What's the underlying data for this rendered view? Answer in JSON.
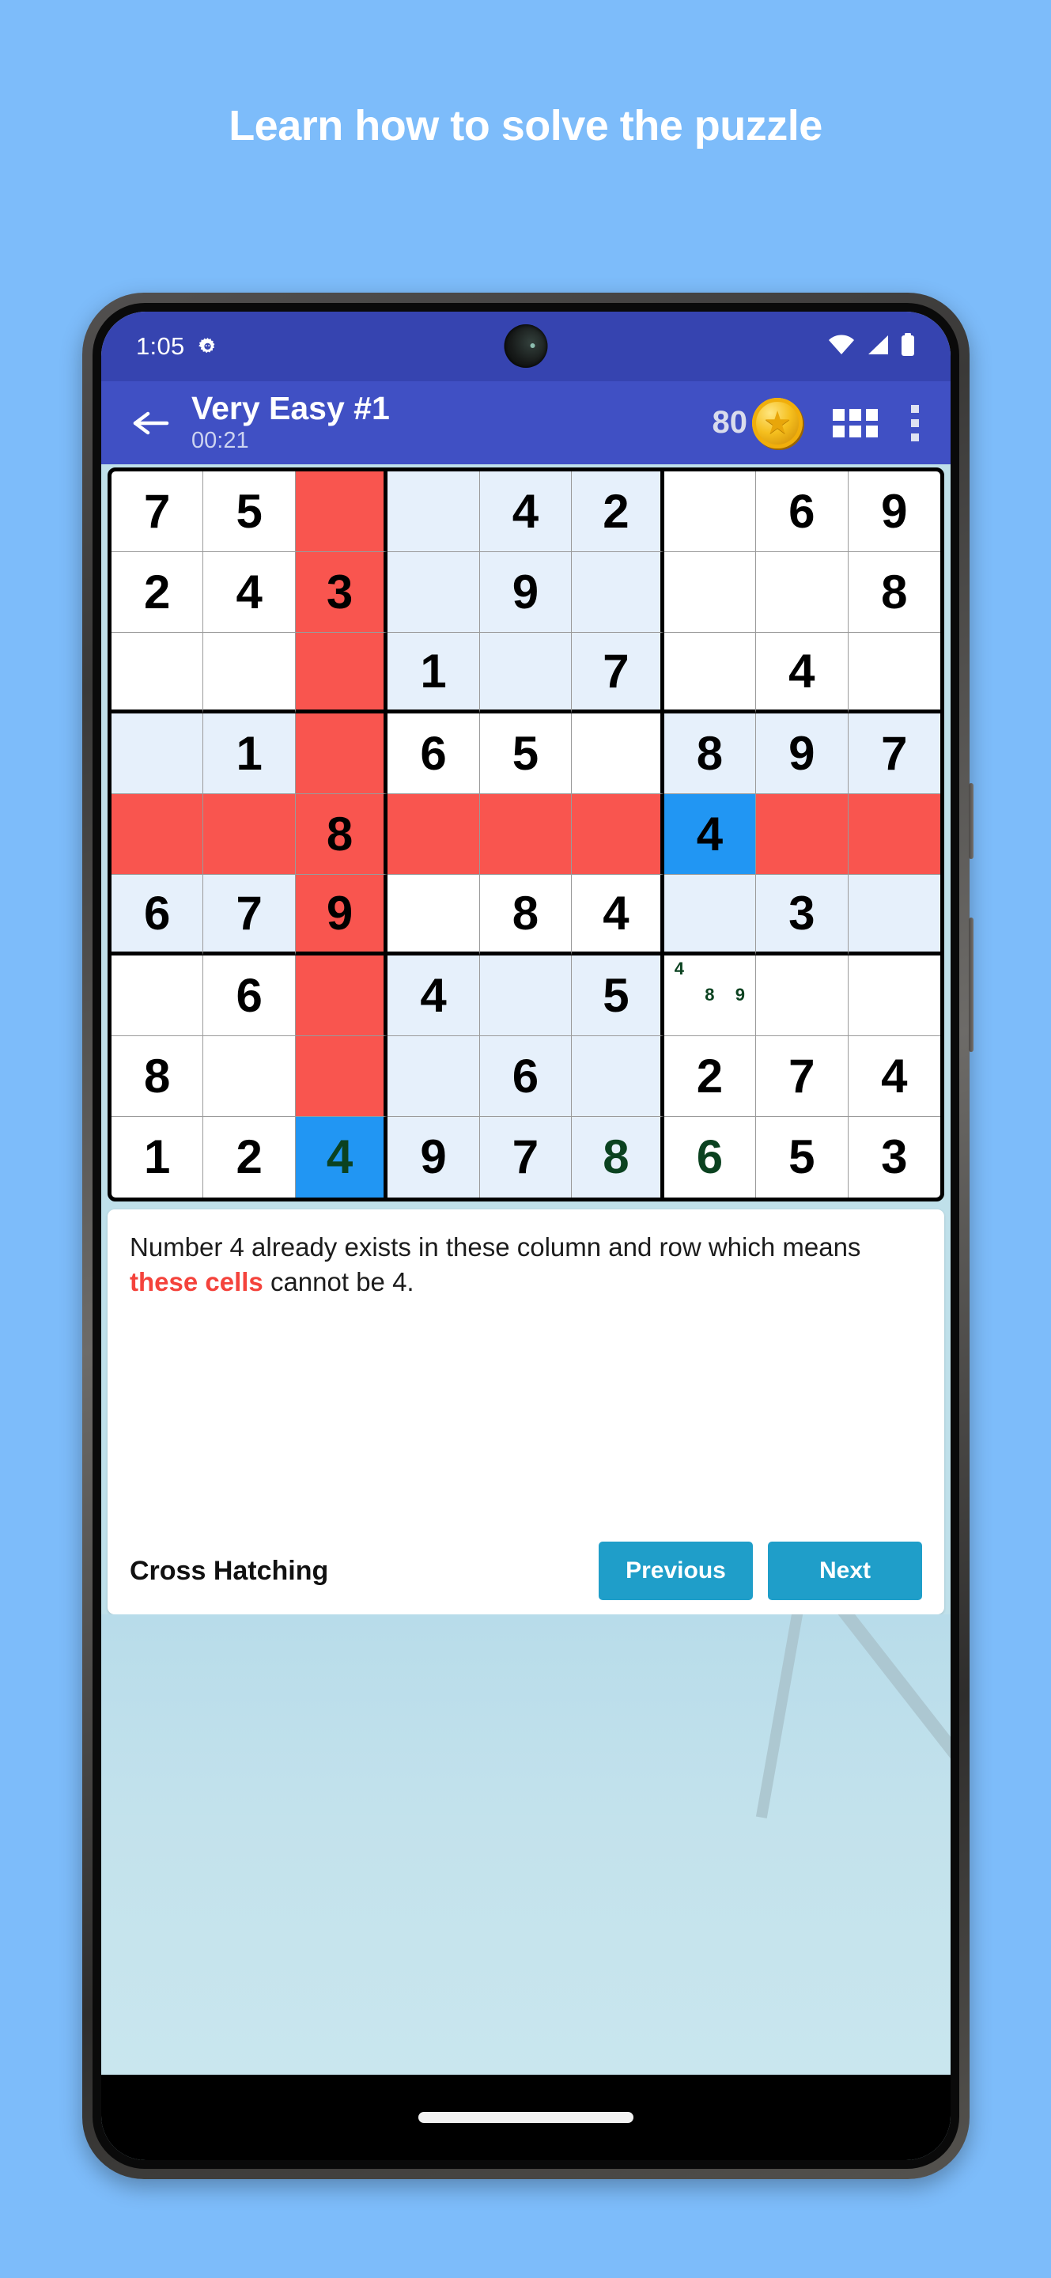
{
  "headline": "Learn how to solve the puzzle",
  "statusbar": {
    "time": "1:05",
    "gear_icon": "gear-icon",
    "wifi_icon": "wifi-icon",
    "signal_icon": "cellular-signal-icon",
    "battery_icon": "battery-icon"
  },
  "appbar": {
    "back_icon": "back-arrow-icon",
    "title": "Very Easy #1",
    "timer": "00:21",
    "score": "80",
    "coin_icon": "star-coin-icon",
    "grid_icon": "grid-view-icon",
    "overflow_icon": "more-vertical-icon"
  },
  "explanation": {
    "text_before": "Number 4 already exists in these column and row which means ",
    "highlight": "these cells",
    "text_after": " cannot be 4.",
    "technique": "Cross Hatching",
    "previous_label": "Previous",
    "next_label": "Next"
  },
  "colors": {
    "page_background": "#7dbcfa",
    "statusbar": "#3644b0",
    "appbar": "#4050c4",
    "conflict_red": "#f9554f",
    "selected_blue": "#2196f3",
    "filled_cell": "#e6f0fb",
    "user_value_green": "#0b4220",
    "button_teal": "#1f9ec9",
    "highlight_red_text": "#f4433c"
  },
  "sudoku": {
    "rows": [
      [
        {
          "v": "7",
          "s": "given"
        },
        {
          "v": "5",
          "s": "given"
        },
        {
          "v": "",
          "s": "red"
        },
        {
          "v": "",
          "s": "filled"
        },
        {
          "v": "4",
          "s": "filled"
        },
        {
          "v": "2",
          "s": "filled"
        },
        {
          "v": "",
          "s": "given"
        },
        {
          "v": "6",
          "s": "given"
        },
        {
          "v": "9",
          "s": "given"
        }
      ],
      [
        {
          "v": "2",
          "s": "given"
        },
        {
          "v": "4",
          "s": "given"
        },
        {
          "v": "3",
          "s": "red"
        },
        {
          "v": "",
          "s": "filled"
        },
        {
          "v": "9",
          "s": "filled"
        },
        {
          "v": "",
          "s": "filled"
        },
        {
          "v": "",
          "s": "given"
        },
        {
          "v": "",
          "s": "given"
        },
        {
          "v": "8",
          "s": "given"
        }
      ],
      [
        {
          "v": "",
          "s": "given"
        },
        {
          "v": "",
          "s": "given"
        },
        {
          "v": "",
          "s": "red"
        },
        {
          "v": "1",
          "s": "filled"
        },
        {
          "v": "",
          "s": "filled"
        },
        {
          "v": "7",
          "s": "filled"
        },
        {
          "v": "",
          "s": "given"
        },
        {
          "v": "4",
          "s": "given"
        },
        {
          "v": "",
          "s": "given"
        }
      ],
      [
        {
          "v": "",
          "s": "filled"
        },
        {
          "v": "1",
          "s": "filled"
        },
        {
          "v": "",
          "s": "red"
        },
        {
          "v": "6",
          "s": "given"
        },
        {
          "v": "5",
          "s": "given"
        },
        {
          "v": "",
          "s": "given"
        },
        {
          "v": "8",
          "s": "filled"
        },
        {
          "v": "9",
          "s": "filled"
        },
        {
          "v": "7",
          "s": "filled"
        }
      ],
      [
        {
          "v": "",
          "s": "red"
        },
        {
          "v": "",
          "s": "red"
        },
        {
          "v": "8",
          "s": "red"
        },
        {
          "v": "",
          "s": "red"
        },
        {
          "v": "",
          "s": "red"
        },
        {
          "v": "",
          "s": "red"
        },
        {
          "v": "4",
          "s": "blue"
        },
        {
          "v": "",
          "s": "red"
        },
        {
          "v": "",
          "s": "red"
        }
      ],
      [
        {
          "v": "6",
          "s": "filled"
        },
        {
          "v": "7",
          "s": "filled"
        },
        {
          "v": "9",
          "s": "red"
        },
        {
          "v": "",
          "s": "given"
        },
        {
          "v": "8",
          "s": "given"
        },
        {
          "v": "4",
          "s": "given"
        },
        {
          "v": "",
          "s": "filled"
        },
        {
          "v": "3",
          "s": "filled"
        },
        {
          "v": "",
          "s": "filled"
        }
      ],
      [
        {
          "v": "",
          "s": "given"
        },
        {
          "v": "6",
          "s": "given"
        },
        {
          "v": "",
          "s": "red"
        },
        {
          "v": "4",
          "s": "filled"
        },
        {
          "v": "",
          "s": "filled"
        },
        {
          "v": "5",
          "s": "filled"
        },
        {
          "v": "",
          "s": "given",
          "notes": [
            "4",
            "",
            "",
            "",
            "8",
            "9",
            "",
            "",
            ""
          ]
        },
        {
          "v": "",
          "s": "given"
        },
        {
          "v": "",
          "s": "given"
        }
      ],
      [
        {
          "v": "8",
          "s": "given"
        },
        {
          "v": "",
          "s": "given"
        },
        {
          "v": "",
          "s": "red"
        },
        {
          "v": "",
          "s": "filled"
        },
        {
          "v": "6",
          "s": "filled"
        },
        {
          "v": "",
          "s": "filled"
        },
        {
          "v": "2",
          "s": "given"
        },
        {
          "v": "7",
          "s": "given"
        },
        {
          "v": "4",
          "s": "given"
        }
      ],
      [
        {
          "v": "1",
          "s": "given"
        },
        {
          "v": "2",
          "s": "given"
        },
        {
          "v": "4",
          "s": "blue",
          "user": true
        },
        {
          "v": "9",
          "s": "filled"
        },
        {
          "v": "7",
          "s": "filled"
        },
        {
          "v": "8",
          "s": "filled",
          "user": true
        },
        {
          "v": "6",
          "s": "given",
          "user": true
        },
        {
          "v": "5",
          "s": "given"
        },
        {
          "v": "3",
          "s": "given"
        }
      ]
    ]
  }
}
